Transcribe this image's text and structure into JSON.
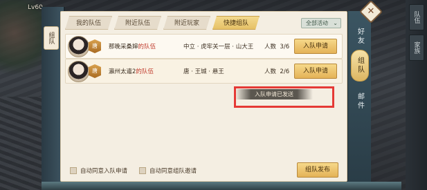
{
  "hud": {
    "top_left": "Lv60"
  },
  "left_tab": {
    "label": "组队"
  },
  "tabs": [
    {
      "label": "我的队伍",
      "active": false
    },
    {
      "label": "附近队伍",
      "active": false
    },
    {
      "label": "附近玩家",
      "active": false
    },
    {
      "label": "快捷组队",
      "active": true
    }
  ],
  "filter": {
    "label": "全部活动"
  },
  "teams": [
    {
      "avatar_badge": "唐",
      "leader": "那晚采桑婶",
      "suffix": "的队伍",
      "location": "中立 · 虎牢关一层 · 山大王",
      "count_label": "人数",
      "count": "3/6",
      "button": "入队申请"
    },
    {
      "avatar_badge": "唐",
      "leader": "瀛州太遣2",
      "suffix": "的队伍",
      "location": "唐 · 王城 · 悬王",
      "count_label": "人数",
      "count": "2/6",
      "button": "入队申请"
    }
  ],
  "toast": "入队申请已发送",
  "footer": {
    "auto_accept_apply": "自动同意入队申请",
    "auto_accept_invite": "自动同意组队邀请",
    "publish_button": "组队发布"
  },
  "side_nav": [
    {
      "label": "好友",
      "active": false
    },
    {
      "label": "组队",
      "active": true
    },
    {
      "label": "邮件",
      "active": false
    }
  ],
  "far_right_tabs": [
    "队伍",
    "家族"
  ],
  "colors": {
    "accent": "#e4b257",
    "highlight_box": "#e53935",
    "panel_bg": "#f4eee2",
    "leader_suffix": "#c0392b"
  }
}
